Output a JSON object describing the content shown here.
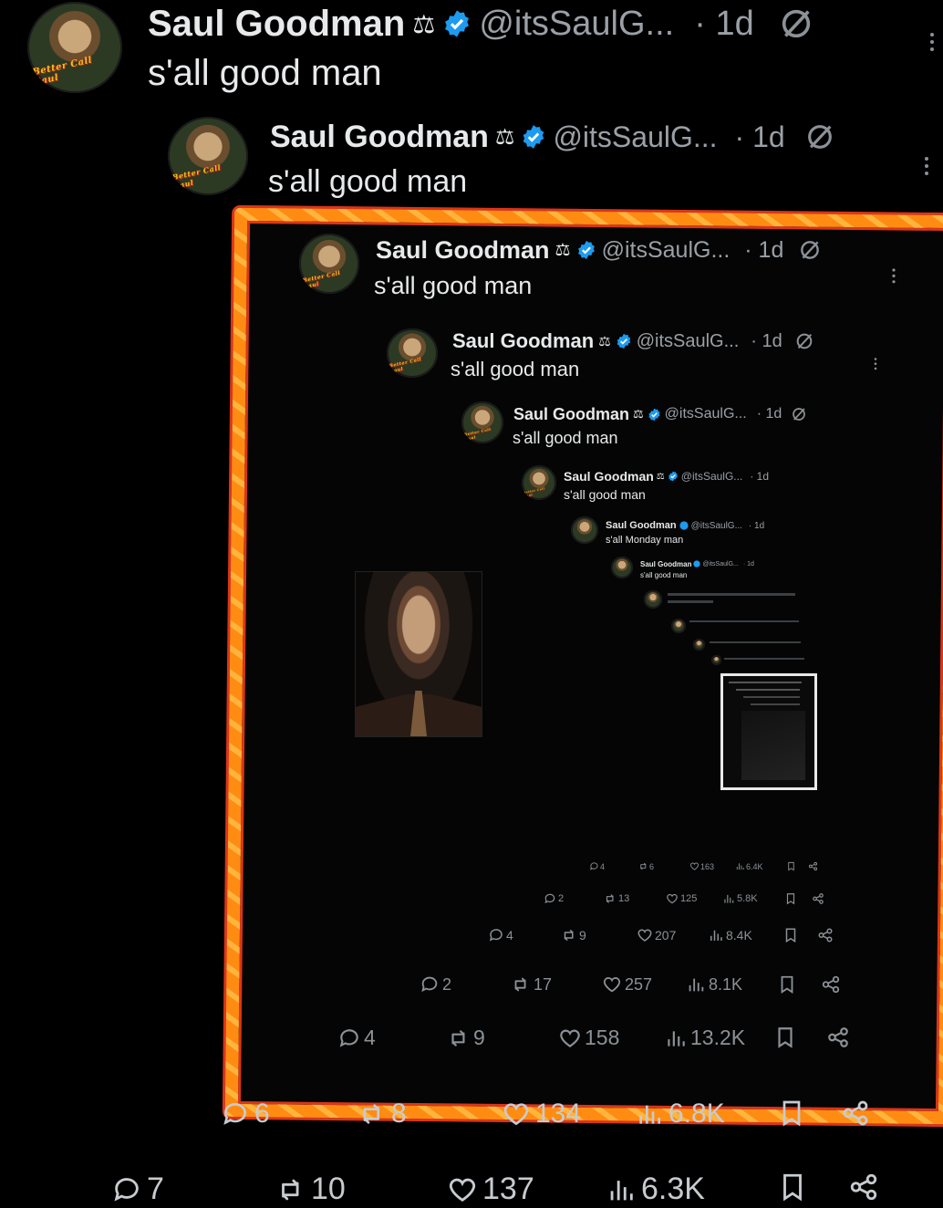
{
  "tweets": [
    {
      "name": "Saul Goodman",
      "emoji": "⚖",
      "handle": "@itsSaulG...",
      "time": "· 1d",
      "text": "s'all good man"
    },
    {
      "name": "Saul Goodman",
      "emoji": "⚖",
      "handle": "@itsSaulG...",
      "time": "· 1d",
      "text": "s'all good man"
    },
    {
      "name": "Saul Goodman",
      "emoji": "⚖",
      "handle": "@itsSaulG...",
      "time": "· 1d",
      "text": "s'all good man"
    },
    {
      "name": "Saul Goodman",
      "emoji": "⚖",
      "handle": "@itsSaulG...",
      "time": "· 1d",
      "text": "s'all good man"
    },
    {
      "name": "Saul Goodman",
      "emoji": "⚖",
      "handle": "@itsSaulG...",
      "time": "· 1d",
      "text": "s'all good man"
    },
    {
      "name": "Saul Goodman",
      "emoji": "⚖",
      "handle": "@itsSaulG...",
      "time": "· 1d",
      "text": "s'all good man"
    },
    {
      "name": "Saul Goodman",
      "emoji": "⚖",
      "handle": "@itsSaulG...",
      "time": "· 1d",
      "text": "s'all Monday man"
    },
    {
      "name": "Saul Goodman",
      "emoji": "⚖",
      "handle": "@itsSaulG...",
      "time": "· 1d",
      "text": "s'all good man"
    }
  ],
  "avatar_logo": "Better Call Saul",
  "action_rows": [
    {
      "replies": "7",
      "reposts": "10",
      "likes": "137",
      "views": "6.3K"
    },
    {
      "replies": "6",
      "reposts": "8",
      "likes": "134",
      "views": "6.8K"
    },
    {
      "replies": "4",
      "reposts": "9",
      "likes": "158",
      "views": "13.2K"
    },
    {
      "replies": "2",
      "reposts": "17",
      "likes": "257",
      "views": "8.1K"
    },
    {
      "replies": "4",
      "reposts": "9",
      "likes": "207",
      "views": "8.4K"
    },
    {
      "replies": "2",
      "reposts": "13",
      "likes": "125",
      "views": "5.8K"
    },
    {
      "replies": "4",
      "reposts": "6",
      "likes": "163",
      "views": "6.4K"
    }
  ],
  "colors": {
    "frame_outer": "#ff8c12",
    "frame_edge": "#d9361b",
    "verified": "#1d9bf0",
    "muted": "#8b9196",
    "text": "#e7e9ea"
  },
  "icons": [
    "reply-icon",
    "repost-icon",
    "like-icon",
    "views-icon",
    "bookmark-icon",
    "share-icon",
    "verified-icon",
    "grok-icon",
    "more-icon",
    "scales-emoji"
  ]
}
